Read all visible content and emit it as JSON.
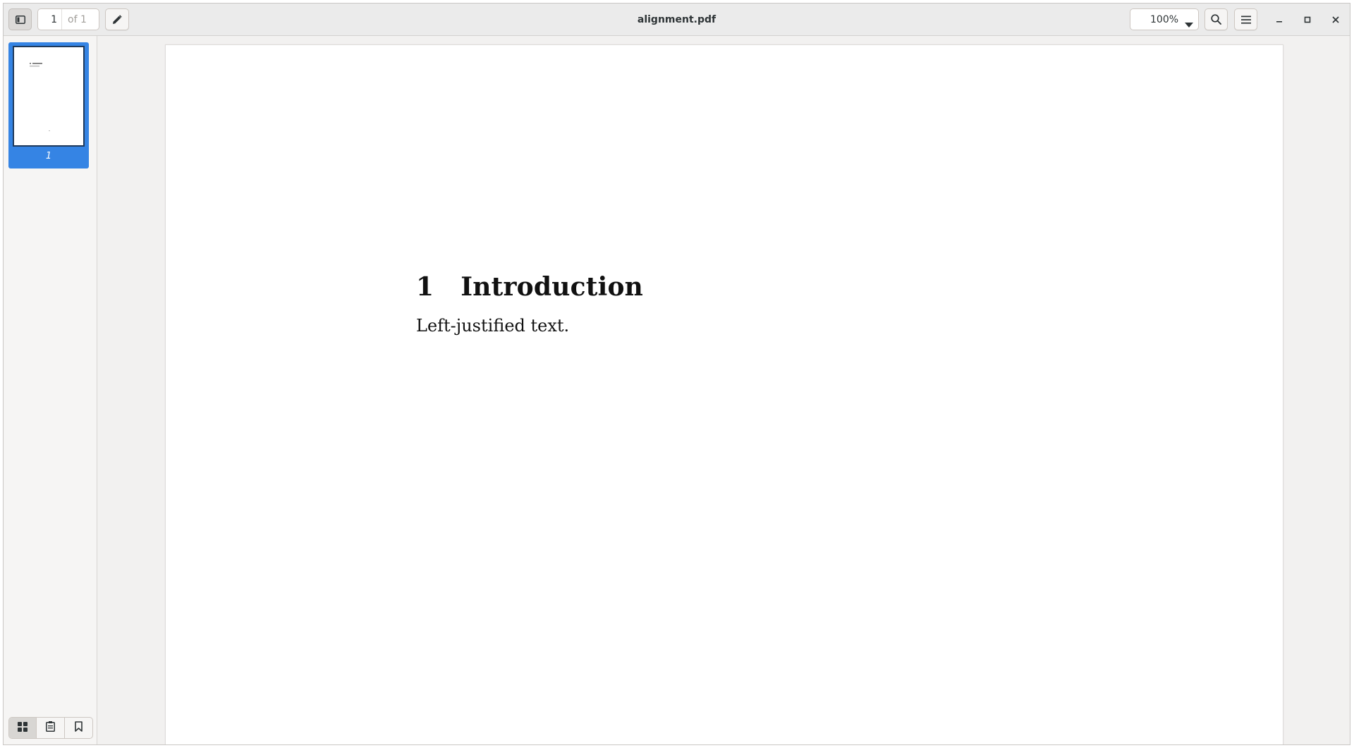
{
  "window": {
    "title": "alignment.pdf"
  },
  "toolbar": {
    "page_current": "1",
    "page_total": "of 1",
    "zoom": "100%",
    "icons": [
      "sidebar-toggle-icon",
      "pencil-icon",
      "search-icon",
      "hamburger-menu-icon",
      "minimize-icon",
      "maximize-icon",
      "close-icon"
    ]
  },
  "sidebar": {
    "thumbnails": [
      {
        "label": "1",
        "selected": true
      }
    ],
    "tabs": [
      "thumbnails-icon",
      "annotations-icon",
      "bookmarks-icon"
    ],
    "accent_color": "#3584e4"
  },
  "document": {
    "section_number": "1",
    "section_title": "Introduction",
    "body_text": "Left-justified text."
  }
}
